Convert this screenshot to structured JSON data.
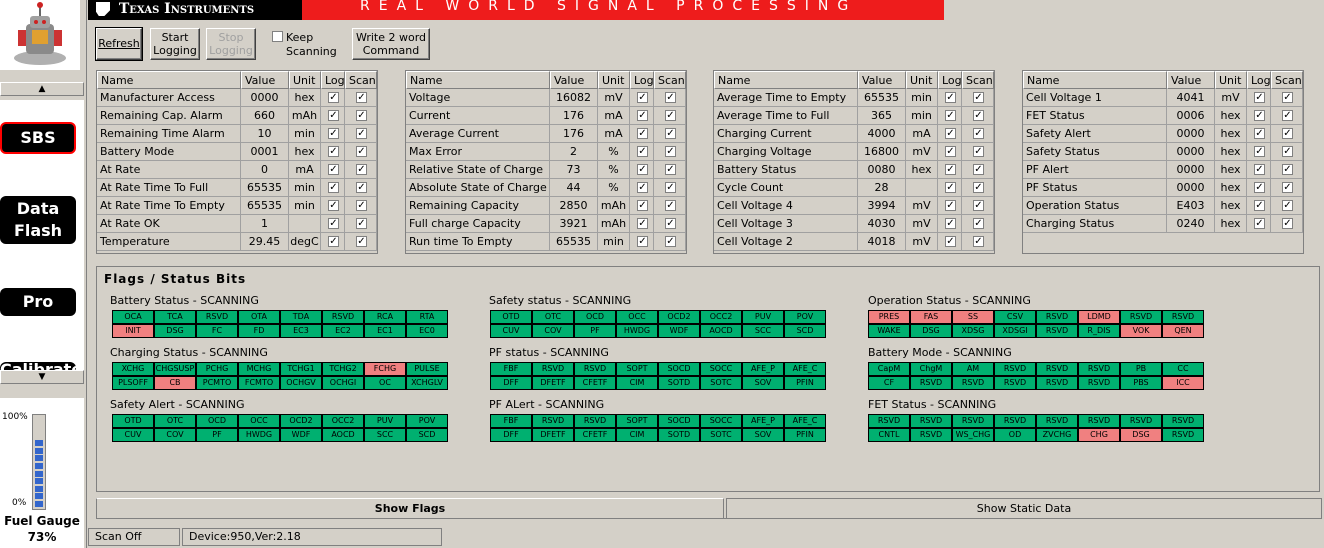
{
  "header": {
    "brand": "Texas Instruments",
    "tagline": "REAL WORLD SIGNAL PROCESSING"
  },
  "nav": {
    "items": [
      "SBS",
      "Data Flash",
      "Pro",
      "Calibrate"
    ],
    "active": "SBS"
  },
  "fuel_gauge": {
    "label": "Fuel Gauge",
    "percent_text": "73%",
    "level": 0.73,
    "scale_top": "100%",
    "scale_bottom": "0%"
  },
  "toolbar": {
    "refresh": "Refresh",
    "start_logging": "Start Logging",
    "stop_logging": "Stop Logging",
    "keep_scanning": "Keep Scanning",
    "write_2_word": "Write 2 word Command"
  },
  "table_headers": {
    "name": "Name",
    "value": "Value",
    "unit": "Unit",
    "log": "Log",
    "scan": "Scan"
  },
  "tables": [
    [
      {
        "name": "Manufacturer Access",
        "value": "0000",
        "unit": "hex",
        "log": true,
        "scan": true
      },
      {
        "name": "Remaining Cap. Alarm",
        "value": "660",
        "unit": "mAh",
        "log": true,
        "scan": true
      },
      {
        "name": "Remaining Time Alarm",
        "value": "10",
        "unit": "min",
        "log": true,
        "scan": true
      },
      {
        "name": "Battery Mode",
        "value": "0001",
        "unit": "hex",
        "log": true,
        "scan": true
      },
      {
        "name": "At Rate",
        "value": "0",
        "unit": "mA",
        "log": true,
        "scan": true
      },
      {
        "name": "At Rate Time To Full",
        "value": "65535",
        "unit": "min",
        "log": true,
        "scan": true
      },
      {
        "name": "At Rate Time To Empty",
        "value": "65535",
        "unit": "min",
        "log": true,
        "scan": true
      },
      {
        "name": "At Rate OK",
        "value": "1",
        "unit": "",
        "log": true,
        "scan": true
      },
      {
        "name": "Temperature",
        "value": "29.45",
        "unit": "degC",
        "log": true,
        "scan": true
      }
    ],
    [
      {
        "name": "Voltage",
        "value": "16082",
        "unit": "mV",
        "log": true,
        "scan": true
      },
      {
        "name": "Current",
        "value": "176",
        "unit": "mA",
        "log": true,
        "scan": true
      },
      {
        "name": "Average Current",
        "value": "176",
        "unit": "mA",
        "log": true,
        "scan": true
      },
      {
        "name": "Max Error",
        "value": "2",
        "unit": "%",
        "log": true,
        "scan": true
      },
      {
        "name": "Relative State of Charge",
        "value": "73",
        "unit": "%",
        "log": true,
        "scan": true
      },
      {
        "name": "Absolute State of Charge",
        "value": "44",
        "unit": "%",
        "log": true,
        "scan": true
      },
      {
        "name": "Remaining Capacity",
        "value": "2850",
        "unit": "mAh",
        "log": true,
        "scan": true
      },
      {
        "name": "Full charge Capacity",
        "value": "3921",
        "unit": "mAh",
        "log": true,
        "scan": true
      },
      {
        "name": "Run time To Empty",
        "value": "65535",
        "unit": "min",
        "log": true,
        "scan": true
      }
    ],
    [
      {
        "name": "Average Time to Empty",
        "value": "65535",
        "unit": "min",
        "log": true,
        "scan": true
      },
      {
        "name": "Average Time to Full",
        "value": "365",
        "unit": "min",
        "log": true,
        "scan": true
      },
      {
        "name": "Charging Current",
        "value": "4000",
        "unit": "mA",
        "log": true,
        "scan": true
      },
      {
        "name": "Charging Voltage",
        "value": "16800",
        "unit": "mV",
        "log": true,
        "scan": true
      },
      {
        "name": "Battery Status",
        "value": "0080",
        "unit": "hex",
        "log": true,
        "scan": true
      },
      {
        "name": "Cycle Count",
        "value": "28",
        "unit": "",
        "log": true,
        "scan": true
      },
      {
        "name": "Cell Voltage 4",
        "value": "3994",
        "unit": "mV",
        "log": true,
        "scan": true
      },
      {
        "name": "Cell Voltage 3",
        "value": "4030",
        "unit": "mV",
        "log": true,
        "scan": true
      },
      {
        "name": "Cell Voltage 2",
        "value": "4018",
        "unit": "mV",
        "log": true,
        "scan": true
      }
    ],
    [
      {
        "name": "Cell Voltage 1",
        "value": "4041",
        "unit": "mV",
        "log": true,
        "scan": true
      },
      {
        "name": "FET Status",
        "value": "0006",
        "unit": "hex",
        "log": true,
        "scan": true
      },
      {
        "name": "Safety Alert",
        "value": "0000",
        "unit": "hex",
        "log": true,
        "scan": true
      },
      {
        "name": "Safety Status",
        "value": "0000",
        "unit": "hex",
        "log": true,
        "scan": true
      },
      {
        "name": "PF Alert",
        "value": "0000",
        "unit": "hex",
        "log": true,
        "scan": true
      },
      {
        "name": "PF Status",
        "value": "0000",
        "unit": "hex",
        "log": true,
        "scan": true
      },
      {
        "name": "Operation Status",
        "value": "E403",
        "unit": "hex",
        "log": true,
        "scan": true
      },
      {
        "name": "Charging Status",
        "value": "0240",
        "unit": "hex",
        "log": true,
        "scan": true
      }
    ]
  ],
  "flags": {
    "title": "Flags / Status Bits",
    "groups": [
      {
        "label": "Battery Status - SCANNING",
        "rows": [
          [
            "OCA",
            "TCA",
            "RSVD",
            "OTA",
            "TDA",
            "RSVD",
            "RCA",
            "RTA"
          ],
          [
            "INIT",
            "DSG",
            "FC",
            "FD",
            "EC3",
            "EC2",
            "EC1",
            "EC0"
          ]
        ],
        "on": [
          [],
          [
            0
          ]
        ]
      },
      {
        "label": "Safety status - SCANNING",
        "rows": [
          [
            "OTD",
            "OTC",
            "OCD",
            "OCC",
            "OCD2",
            "OCC2",
            "PUV",
            "POV"
          ],
          [
            "CUV",
            "COV",
            "PF",
            "HWDG",
            "WDF",
            "AOCD",
            "SCC",
            "SCD"
          ]
        ],
        "on": [
          [],
          []
        ]
      },
      {
        "label": "Operation Status - SCANNING",
        "rows": [
          [
            "PRES",
            "FAS",
            "SS",
            "CSV",
            "RSVD",
            "LDMD",
            "RSVD",
            "RSVD"
          ],
          [
            "WAKE",
            "DSG",
            "XDSG",
            "XDSGI",
            "RSVD",
            "R_DIS",
            "VOK",
            "QEN"
          ]
        ],
        "on": [
          [
            0,
            1,
            2,
            5
          ],
          [
            6,
            7
          ]
        ]
      },
      {
        "label": "Charging Status - SCANNING",
        "rows": [
          [
            "XCHG",
            "CHGSUSP",
            "PCHG",
            "MCHG",
            "TCHG1",
            "TCHG2",
            "FCHG",
            "PULSE"
          ],
          [
            "PLSOFF",
            "CB",
            "PCMTO",
            "FCMTO",
            "OCHGV",
            "OCHGI",
            "OC",
            "XCHGLV"
          ]
        ],
        "on": [
          [
            6
          ],
          [
            1
          ]
        ]
      },
      {
        "label": "PF status - SCANNING",
        "rows": [
          [
            "FBF",
            "RSVD",
            "RSVD",
            "SOPT",
            "SOCD",
            "SOCC",
            "AFE_P",
            "AFE_C"
          ],
          [
            "DFF",
            "DFETF",
            "CFETF",
            "CIM",
            "SOTD",
            "SOTC",
            "SOV",
            "PFIN"
          ]
        ],
        "on": [
          [],
          []
        ]
      },
      {
        "label": "Battery Mode - SCANNING",
        "rows": [
          [
            "CapM",
            "ChgM",
            "AM",
            "RSVD",
            "RSVD",
            "RSVD",
            "PB",
            "CC"
          ],
          [
            "CF",
            "RSVD",
            "RSVD",
            "RSVD",
            "RSVD",
            "RSVD",
            "PBS",
            "ICC"
          ]
        ],
        "on": [
          [],
          [
            7
          ]
        ]
      },
      {
        "label": "Safety Alert - SCANNING",
        "rows": [
          [
            "OTD",
            "OTC",
            "OCD",
            "OCC",
            "OCD2",
            "OCC2",
            "PUV",
            "POV"
          ],
          [
            "CUV",
            "COV",
            "PF",
            "HWDG",
            "WDF",
            "AOCD",
            "SCC",
            "SCD"
          ]
        ],
        "on": [
          [],
          []
        ]
      },
      {
        "label": "PF ALert - SCANNING",
        "rows": [
          [
            "FBF",
            "RSVD",
            "RSVD",
            "SOPT",
            "SOCD",
            "SOCC",
            "AFE_P",
            "AFE_C"
          ],
          [
            "DFF",
            "DFETF",
            "CFETF",
            "CIM",
            "SOTD",
            "SOTC",
            "SOV",
            "PFIN"
          ]
        ],
        "on": [
          [],
          []
        ]
      },
      {
        "label": "FET Status - SCANNING",
        "rows": [
          [
            "RSVD",
            "RSVD",
            "RSVD",
            "RSVD",
            "RSVD",
            "RSVD",
            "RSVD",
            "RSVD"
          ],
          [
            "CNTL",
            "RSVD",
            "WS_CHG",
            "OD",
            "ZVCHG",
            "CHG",
            "DSG",
            "RSVD"
          ]
        ],
        "on": [
          [],
          [
            5,
            6
          ]
        ]
      }
    ]
  },
  "tabs": {
    "show_flags": "Show Flags",
    "show_static": "Show Static Data"
  },
  "status": {
    "scan": "Scan Off",
    "device": "Device:950,Ver:2.18"
  },
  "colors": {
    "flag_off": "#00b070",
    "flag_on": "#f08080",
    "ti_red": "#ee1c1c"
  }
}
